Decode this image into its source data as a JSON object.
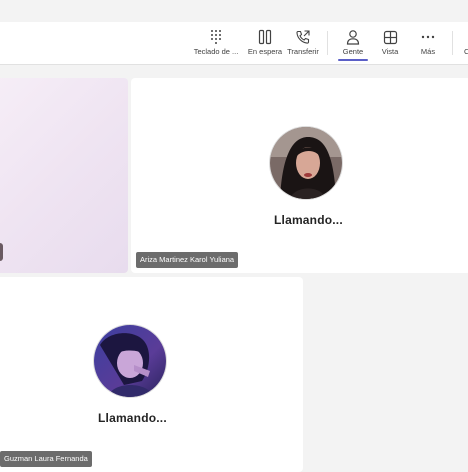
{
  "toolbar": {
    "items": [
      {
        "label": "Teclado de ...",
        "icon": "dialpad-icon"
      },
      {
        "label": "En espera",
        "icon": "pause-icon"
      },
      {
        "label": "Transferir",
        "icon": "transfer-call-icon"
      },
      {
        "label": "Gente",
        "icon": "people-icon",
        "active": true
      },
      {
        "label": "Vista",
        "icon": "grid-view-icon"
      },
      {
        "label": "Más",
        "icon": "more-icon"
      }
    ],
    "overflow_label": "C"
  },
  "participants": [
    {
      "name": "Ariza Martinez Karol Yuliana",
      "status": "Llamando..."
    },
    {
      "name": "Guzman Laura Fernanda",
      "status": "Llamando..."
    }
  ],
  "colors": {
    "accent": "#5b5fc7",
    "tag_bg": "#5f5f5f"
  }
}
